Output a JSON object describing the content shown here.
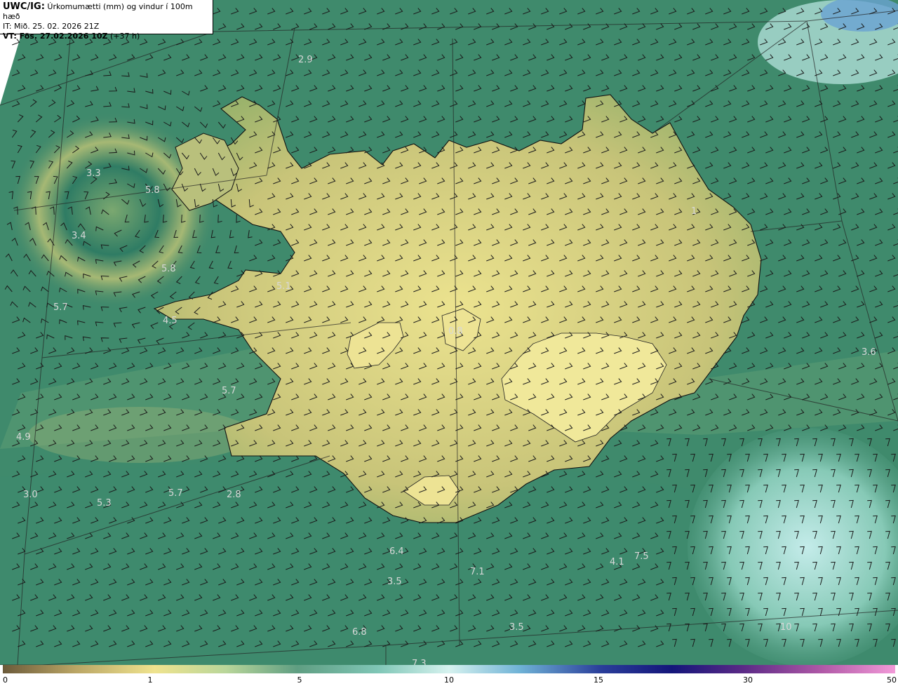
{
  "header": {
    "product": "UWC/IG:",
    "title": "Úrkomumætti (mm) og vindur í 100m hæð",
    "it_line": "IT: Mið. 25. 02. 2026 21Z",
    "vt_label": "VT: Fös. 27.02.2026 10Z",
    "vt_offset": "(+37 h)"
  },
  "map_labels": [
    "2.9",
    "3.3",
    "5.8",
    "3.4",
    "5.8",
    "5.1",
    "5.7",
    "4.5",
    "5.7",
    "4.9",
    "3.0",
    "5.3",
    "5.7",
    "2.8",
    "0.8",
    "1",
    "6.4",
    "3.5",
    "7.1",
    "4.1",
    "7.5",
    "6.8",
    "3.5",
    "3.6",
    "10",
    "7.3"
  ],
  "colorbar": {
    "ticks": [
      "0",
      "1",
      "5",
      "10",
      "15",
      "30",
      "50"
    ],
    "colors": [
      "#6b5a3a",
      "#b9a464",
      "#efe38e",
      "#b9d69a",
      "#5f9e82",
      "#7fc6b6",
      "#d6f2ef",
      "#6fb2d6",
      "#2a3e9a",
      "#14157a",
      "#5b2a86",
      "#b25aa8",
      "#f29ad8"
    ]
  },
  "palette": {
    "sea": "#3f8a6c",
    "land": "#d9d484",
    "wet_sea": "#8ccfc2",
    "coast": "#111111"
  }
}
